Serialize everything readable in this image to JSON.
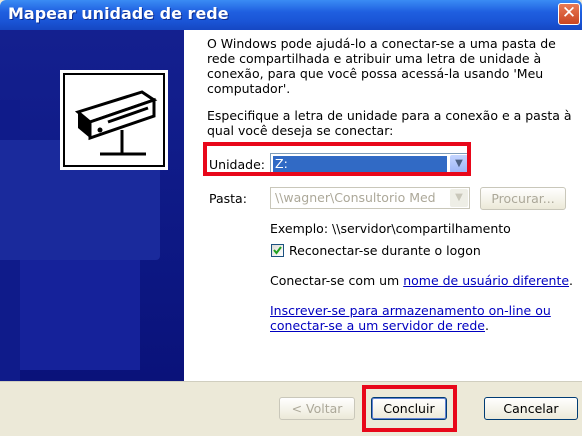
{
  "window": {
    "title": "Mapear unidade de rede",
    "close_glyph": "✕"
  },
  "intro": {
    "line1": "O Windows pode ajudá-lo a conectar-se a uma pasta de",
    "line2": "rede compartilhada e atribuir uma letra de unidade à",
    "line3": "conexão, para que você possa acessá-la usando 'Meu",
    "line4": "computador'."
  },
  "specify": {
    "line1": "Especifique a letra de unidade para a conexão e a pasta à",
    "line2": "qual você deseja se conectar:"
  },
  "drive": {
    "label": "Unidade:",
    "value": "Z:"
  },
  "folder": {
    "label": "Pasta:",
    "value": "\\\\wagner\\Consultorio Med",
    "browse_label": "Procurar..."
  },
  "example": "Exemplo: \\\\servidor\\compartilhamento",
  "reconnect": {
    "label": "Reconectar-se durante o logon",
    "checked": true
  },
  "connect_as": {
    "prefix": "Conectar-se com um ",
    "link": "nome de usuário diferente",
    "suffix": "."
  },
  "signup_link": {
    "line1": "Inscrever-se para armazenamento on-line ou",
    "line2": "conectar-se a um servidor de rede",
    "suffix": "."
  },
  "buttons": {
    "back": "< Voltar",
    "finish": "Concluir",
    "cancel": "Cancelar"
  },
  "icons": {
    "dropdown": "chevron-down-icon",
    "network_drive": "network-drive-icon",
    "close": "close-icon"
  },
  "colors": {
    "titlebar": "#1f5fe0",
    "left_panel": "#0d1884",
    "highlight": "#e8071a",
    "selection": "#316ac5",
    "link": "#0000c0"
  }
}
